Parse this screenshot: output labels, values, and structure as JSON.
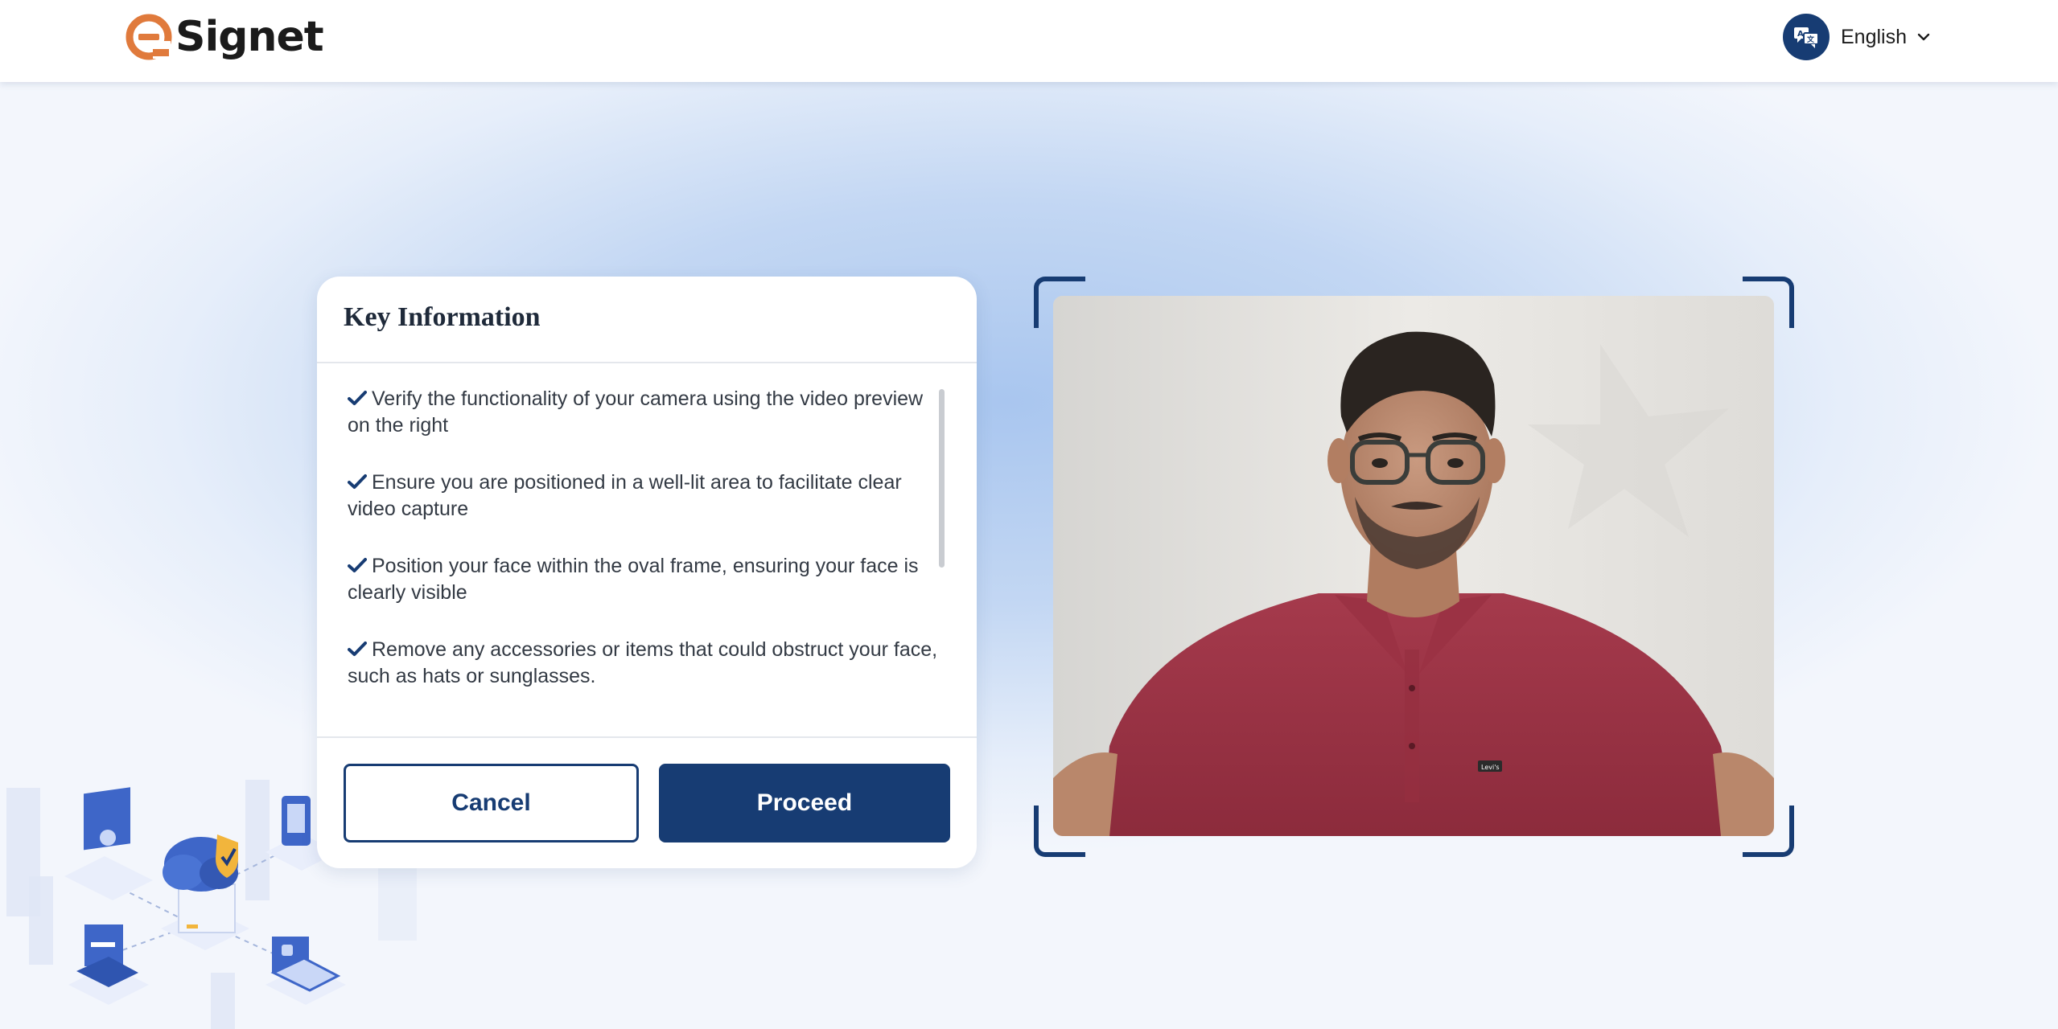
{
  "header": {
    "brand": "Signet",
    "language": {
      "label": "English",
      "icon": "language-translate-icon"
    }
  },
  "key_info": {
    "title": "Key Information",
    "items": [
      {
        "icon": "check-icon",
        "text": "Verify the functionality of your camera using the video preview on the right"
      },
      {
        "icon": "check-icon",
        "text": "Ensure you are positioned in a well-lit area to facilitate clear video capture"
      },
      {
        "icon": "check-icon",
        "text": "Position your face within the oval frame, ensuring your face is clearly visible"
      },
      {
        "icon": "check-icon",
        "text": "Remove any accessories or items that could obstruct your face, such as hats or sunglasses."
      }
    ],
    "buttons": {
      "cancel": "Cancel",
      "proceed": "Proceed"
    }
  },
  "camera": {
    "shirt_logo_text": "Levi's"
  },
  "colors": {
    "primary": "#173c73",
    "brand_orange": "#e07a3c",
    "background_blue": "#a9c6ef"
  }
}
